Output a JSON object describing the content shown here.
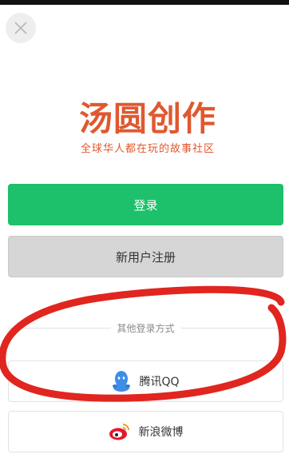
{
  "header": {
    "close_icon": "close-icon"
  },
  "brand": {
    "title": "汤圆创作",
    "slogan": "全球华人都在玩的故事社区",
    "color": "#e0582f"
  },
  "actions": {
    "login_label": "登录",
    "register_label": "新用户注册",
    "primary_color": "#1dc06b"
  },
  "other_login": {
    "title": "其他登录方式",
    "options": [
      {
        "label": "腾讯QQ",
        "icon": "qq-icon"
      },
      {
        "label": "新浪微博",
        "icon": "weibo-icon"
      }
    ]
  },
  "annotation_color": "#e0261f"
}
